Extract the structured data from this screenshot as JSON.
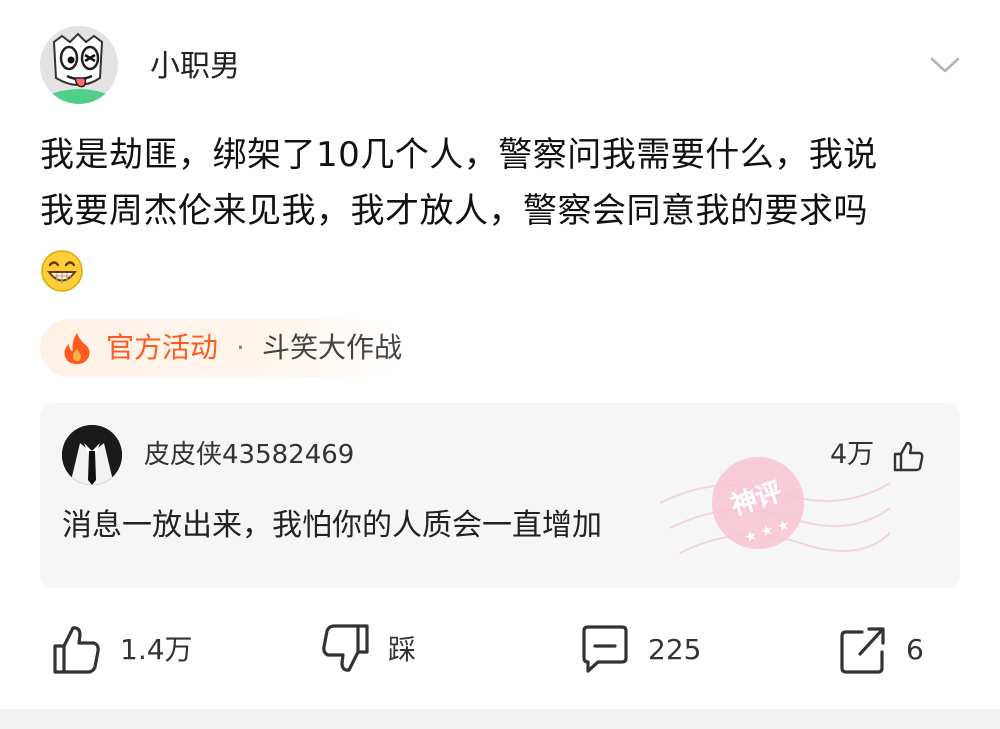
{
  "post": {
    "author": "小职男",
    "text": "我是劫匪，绑架了10几个人，警察问我需要什么，我说\n我要周杰伦来见我，我才放人，警察会同意我的要求吗",
    "emoji": "grinning-face-icon"
  },
  "activity": {
    "label": "官方活动",
    "separator": "·",
    "name": "斗笑大作战",
    "accent": "#ff5a1f"
  },
  "hot_comment": {
    "user": "皮皮侠43582469",
    "likes": "4万",
    "text": "消息一放出来，我怕你的人质会一直增加",
    "badge": "神评"
  },
  "actions": {
    "like_count": "1.4万",
    "dislike_label": "踩",
    "comment_count": "225",
    "share_count": "6"
  },
  "icons": {
    "menu": "chevron-down-icon",
    "like": "thumbs-up-icon",
    "dislike": "thumbs-down-icon",
    "comment": "comment-icon",
    "share": "share-icon",
    "fire": "fire-icon"
  }
}
